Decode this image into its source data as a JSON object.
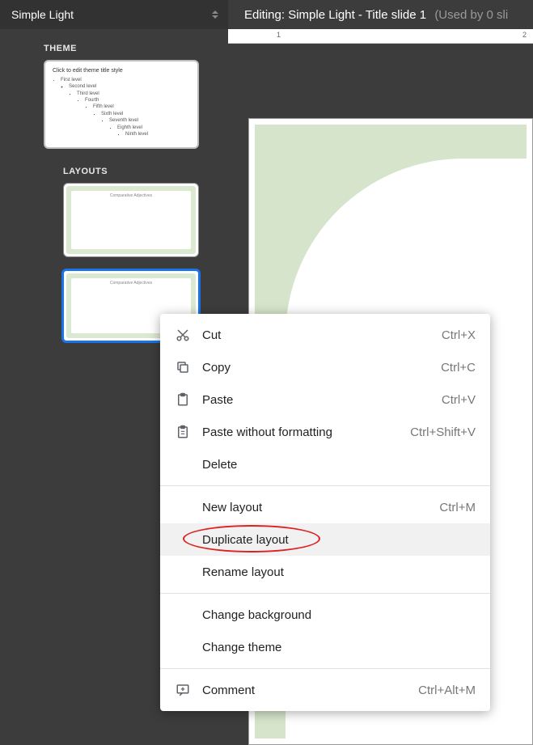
{
  "header": {
    "themeName": "Simple Light",
    "editingPrefix": "Editing:",
    "editingTitle": "Simple Light - Title slide 1",
    "usedBy": "(Used by 0 sli"
  },
  "sidebar": {
    "themeLabel": "THEME",
    "layoutsLabel": "LAYOUTS",
    "themeThumbTitle": "Click to edit theme title style",
    "themeOutline": [
      "First level",
      "Second level",
      "Third level",
      "Fourth",
      "Fifth level",
      "Sixth level",
      "Seventh level",
      "Eighth level",
      "Ninth level"
    ],
    "layouts": [
      {
        "title": "Comparative Adjectives",
        "selected": false
      },
      {
        "title": "Comparative Adjectives",
        "selected": true
      }
    ]
  },
  "ruler": {
    "mark1": "1",
    "mark2": "2"
  },
  "contextMenu": {
    "items": [
      {
        "icon": "cut-icon",
        "label": "Cut",
        "shortcut": "Ctrl+X"
      },
      {
        "icon": "copy-icon",
        "label": "Copy",
        "shortcut": "Ctrl+C"
      },
      {
        "icon": "paste-icon",
        "label": "Paste",
        "shortcut": "Ctrl+V"
      },
      {
        "icon": "paste-plain-icon",
        "label": "Paste without formatting",
        "shortcut": "Ctrl+Shift+V"
      },
      {
        "icon": "",
        "label": "Delete",
        "shortcut": ""
      },
      {
        "separator": true
      },
      {
        "icon": "",
        "label": "New layout",
        "shortcut": "Ctrl+M"
      },
      {
        "icon": "",
        "label": "Duplicate layout",
        "shortcut": "",
        "hover": true,
        "highlight": true
      },
      {
        "icon": "",
        "label": "Rename layout",
        "shortcut": ""
      },
      {
        "separator": true
      },
      {
        "icon": "",
        "label": "Change background",
        "shortcut": ""
      },
      {
        "icon": "",
        "label": "Change theme",
        "shortcut": ""
      },
      {
        "separator": true
      },
      {
        "icon": "comment-icon",
        "label": "Comment",
        "shortcut": "Ctrl+Alt+M"
      }
    ]
  }
}
